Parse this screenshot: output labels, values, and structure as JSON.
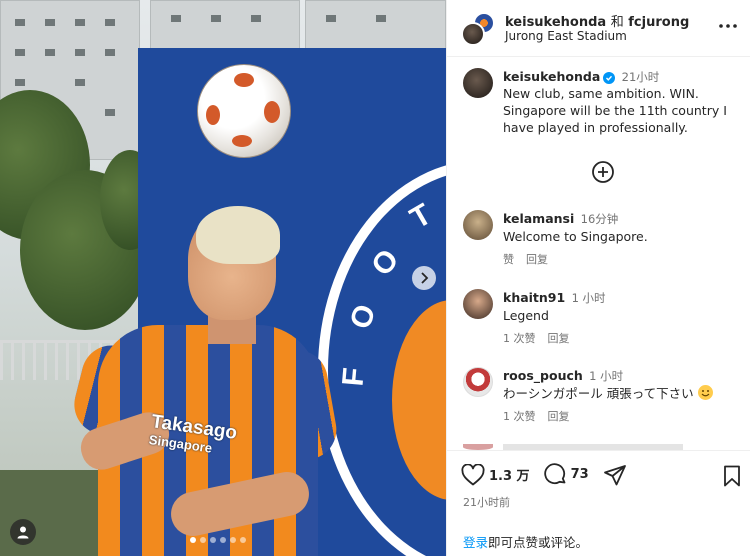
{
  "post": {
    "header": {
      "username": "keisukehonda",
      "conjunction": "和",
      "collaborator": "fcjurong",
      "location": "Jurong East Stadium",
      "more_icon": "more-horizontal-icon"
    },
    "caption": {
      "username": "keisukehonda",
      "verified": true,
      "time": "21小时",
      "text": "New club, same ambition. WIN. Singapore will be the 11th country I have played in professionally."
    },
    "photo": {
      "sponsor_line1": "Takasago",
      "sponsor_line2": "Singapore",
      "crest_letters": [
        "F",
        "O",
        "O",
        "T"
      ],
      "carousel_dots": 6,
      "active_dot": 0
    },
    "comments": [
      {
        "username": "kelamansi",
        "time": "16分钟",
        "text": "Welcome to Singapore.",
        "like_label": "赞",
        "reply_label": "回复"
      },
      {
        "username": "khaitn91",
        "time": "1 小时",
        "text": "Legend",
        "like_label": "1 次赞",
        "reply_label": "回复"
      },
      {
        "username": "roos_pouch",
        "time": "1 小时",
        "text": "わーシンガポール 頑張って下さい",
        "like_label": "1 次赞",
        "reply_label": "回复"
      }
    ],
    "actions": {
      "likes": "1.3 万",
      "comments": "73",
      "time_ago": "21小时前"
    },
    "login_prompt": {
      "link": "登录",
      "rest": "即可点赞或评论。"
    }
  },
  "colors": {
    "link": "#0095f6",
    "muted": "#737373",
    "club_blue": "#1f4a9c",
    "club_orange": "#f28a1e"
  }
}
